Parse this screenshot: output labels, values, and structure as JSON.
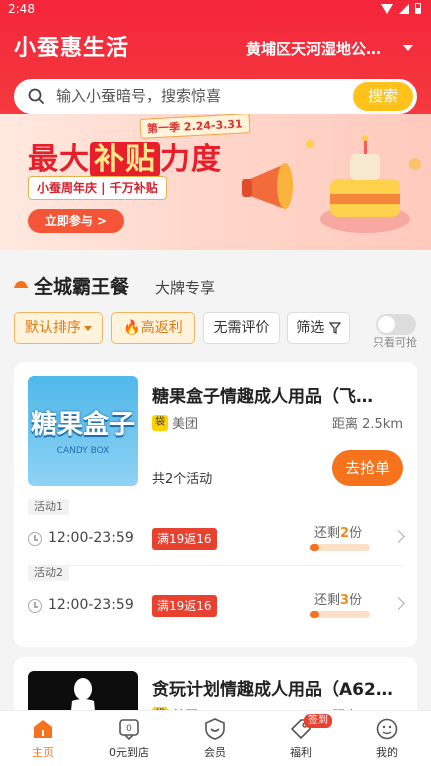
{
  "status_bar": {
    "time": "2:48"
  },
  "header": {
    "app_title": "小蚕惠生活",
    "location": "黄埔区天河湿地公…",
    "search_placeholder": "输入小蚕暗号，搜索惊喜",
    "search_button": "搜索"
  },
  "banner": {
    "season": "第一季 2.24-3.31",
    "headline_a": "最大",
    "headline_b": "补贴",
    "headline_c": "力度",
    "subline": "小蚕周年庆 | 千万补贴",
    "cta": "立即参与 >"
  },
  "section": {
    "title": "全城霸王餐",
    "subtitle": "大牌专享"
  },
  "filters": {
    "sort": "默认排序",
    "hot": "🔥高返利",
    "no_review": "无需评价",
    "filter": "筛选",
    "toggle_label": "只看可抢"
  },
  "shops": [
    {
      "thumb_title": "糖果盒子",
      "thumb_sub": "CANDY BOX",
      "name": "糖果盒子情趣成人用品（飞…",
      "platform": "美团",
      "distance": "距离 2.5km",
      "activity_count": "共2个活动",
      "button": "去抢单",
      "activities": [
        {
          "tag": "活动1",
          "time": "12:00-23:59",
          "badge": "满19返16",
          "remain_prefix": "还剩",
          "remain_num": "2",
          "remain_suffix": "份",
          "progress": 0.15
        },
        {
          "tag": "活动2",
          "time": "12:00-23:59",
          "badge": "满19返16",
          "remain_prefix": "还剩",
          "remain_num": "3",
          "remain_suffix": "份",
          "progress": 0.15
        }
      ]
    },
    {
      "name": "贪玩计划情趣成人用品（A62…",
      "platform": "美团",
      "distance": "距离 2.5km"
    }
  ],
  "bottom_nav": [
    {
      "label": "主页",
      "active": true
    },
    {
      "label": "0元到店"
    },
    {
      "label": "会员"
    },
    {
      "label": "福利",
      "badge": "签到"
    },
    {
      "label": "我的"
    }
  ],
  "colors": {
    "brand_red": "#f4253a",
    "accent_orange": "#f7721d",
    "yellow": "#ffc21a"
  }
}
